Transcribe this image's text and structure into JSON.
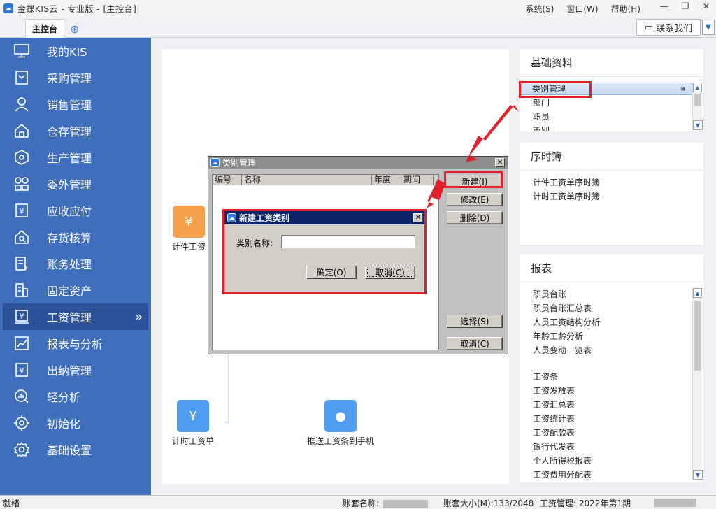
{
  "window": {
    "title": "金蝶KIS云 - 专业版 - [主控台]",
    "menus": [
      "系统(S)",
      "窗口(W)",
      "帮助(H)"
    ]
  },
  "tabs": {
    "main": "主控台",
    "contact": "联系我们"
  },
  "sidebar": {
    "items": [
      {
        "label": "我的KIS",
        "icon": "monitor-icon"
      },
      {
        "label": "采购管理",
        "icon": "purchase-icon"
      },
      {
        "label": "销售管理",
        "icon": "sales-icon"
      },
      {
        "label": "仓存管理",
        "icon": "warehouse-icon"
      },
      {
        "label": "生产管理",
        "icon": "production-icon"
      },
      {
        "label": "委外管理",
        "icon": "outsource-icon"
      },
      {
        "label": "应收应付",
        "icon": "receivable-icon"
      },
      {
        "label": "存货核算",
        "icon": "inventory-icon"
      },
      {
        "label": "账务处理",
        "icon": "accounting-icon"
      },
      {
        "label": "固定资产",
        "icon": "asset-icon"
      },
      {
        "label": "工资管理",
        "icon": "salary-icon",
        "active": true
      },
      {
        "label": "报表与分析",
        "icon": "report-icon"
      },
      {
        "label": "出纳管理",
        "icon": "cashier-icon"
      },
      {
        "label": "轻分析",
        "icon": "analysis-icon"
      },
      {
        "label": "初始化",
        "icon": "init-icon"
      },
      {
        "label": "基础设置",
        "icon": "settings-icon"
      }
    ]
  },
  "workflow": {
    "piece_wage": "计件工资",
    "time_wage": "计时工资单",
    "push_payslip": "推送工资条到手机"
  },
  "basic_info": {
    "title": "基础资料",
    "selected": "类别管理",
    "items": [
      "部门",
      "职员",
      "币别"
    ]
  },
  "timesheet": {
    "title": "序时簿",
    "items": [
      "计件工资单序时簿",
      "计时工资单序时簿"
    ]
  },
  "reports": {
    "title": "报表",
    "group1": [
      "职员台账",
      "职员台账汇总表",
      "人员工资结构分析",
      "年龄工龄分析",
      "人员变动一览表"
    ],
    "group2": [
      "工资条",
      "工资发放表",
      "工资汇总表",
      "工资统计表",
      "工资配款表",
      "银行代发表",
      "个人所得税报表",
      "工资费用分配表"
    ]
  },
  "category_dialog": {
    "title": "类别管理",
    "columns": [
      "编号",
      "名称",
      "年度",
      "期间"
    ],
    "buttons": {
      "new": "新建(I)",
      "modify": "修改(E)",
      "delete": "删除(D)",
      "select": "选择(S)",
      "cancel": "取消(C)"
    }
  },
  "new_category_dialog": {
    "title": "新建工资类别",
    "name_label": "类别名称:",
    "name_value": "",
    "ok": "确定(O)",
    "cancel": "取消(C)"
  },
  "status": {
    "ready": "就绪",
    "account_label": "账套名称:",
    "size_label": "账套大小(M):",
    "size_value": "133/2048",
    "module": "工资管理: 2022年第1期"
  },
  "colors": {
    "sidebar": "#3f6fbc",
    "highlight": "#e0202a",
    "accent": "#2f7ad9"
  }
}
